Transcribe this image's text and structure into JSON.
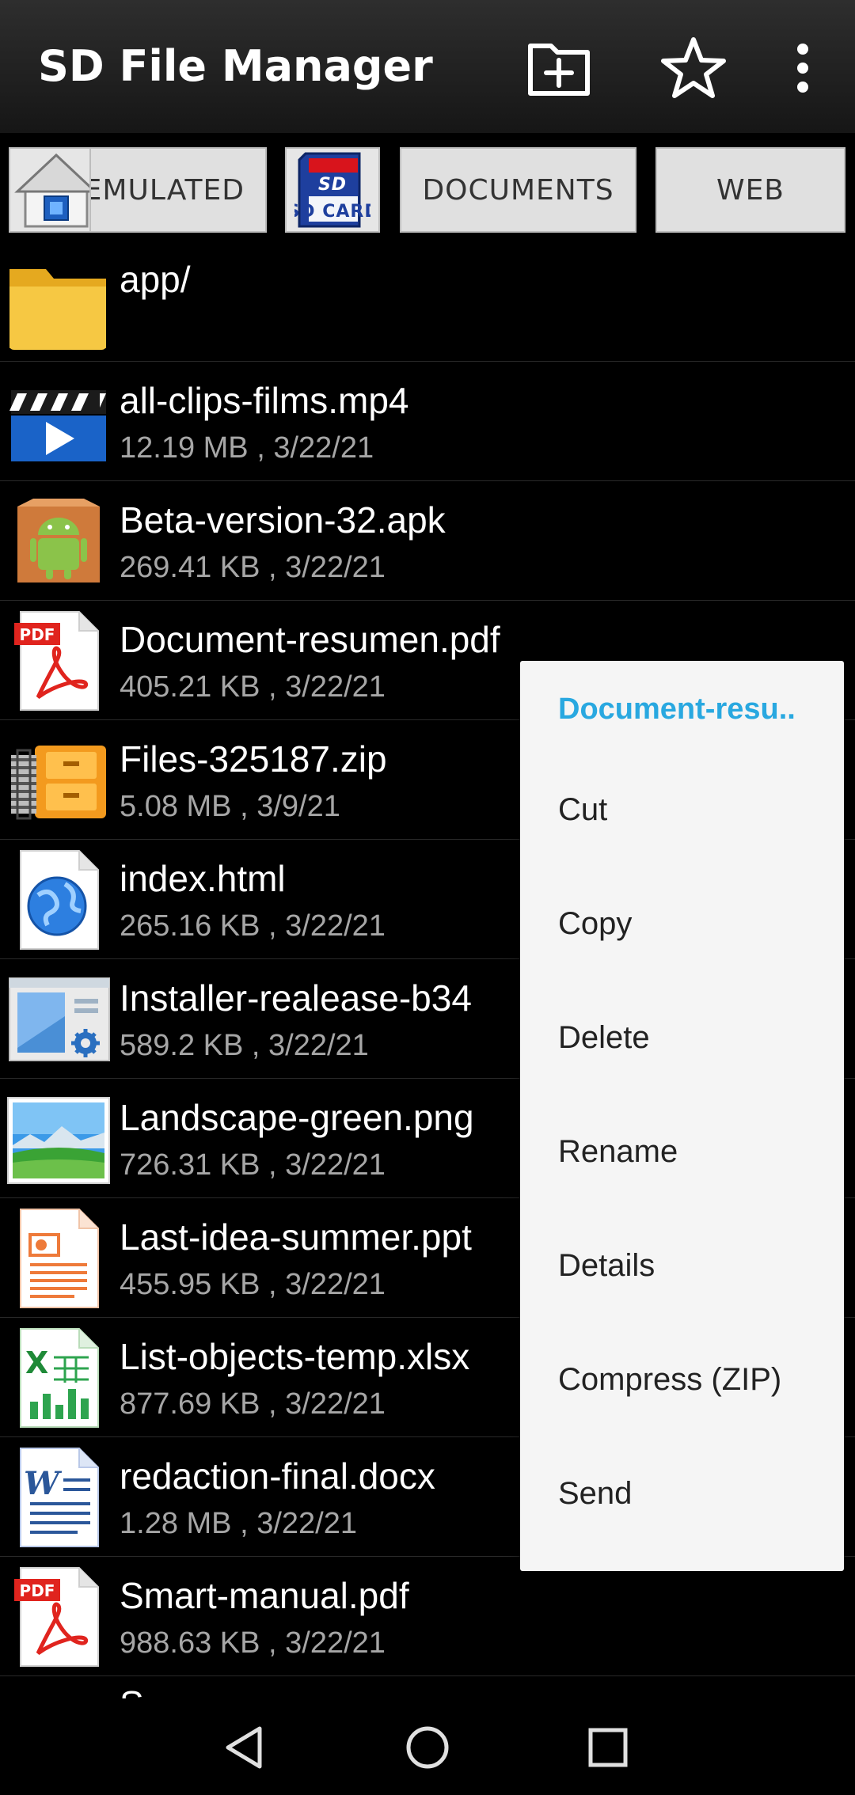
{
  "app": {
    "title": "SD File Manager"
  },
  "toolbar": {
    "new_folder_icon": "folder-plus-icon",
    "favorites_icon": "star-icon",
    "overflow_icon": "more-vert-icon"
  },
  "locations": [
    {
      "type": "home",
      "label": ""
    },
    {
      "type": "text",
      "label": "EMULATED"
    },
    {
      "type": "sdcard",
      "label": "SD CARD"
    },
    {
      "type": "text",
      "label": "DOCUMENTS"
    },
    {
      "type": "text",
      "label": "WEB"
    }
  ],
  "files": [
    {
      "name": "app/",
      "meta": "",
      "icon": "folder-icon"
    },
    {
      "name": "all-clips-films.mp4",
      "meta": "12.19 MB , 3/22/21",
      "icon": "video-icon"
    },
    {
      "name": "Beta-version-32.apk",
      "meta": "269.41 KB , 3/22/21",
      "icon": "android-apk-icon"
    },
    {
      "name": "Document-resumen.pdf",
      "meta": "405.21 KB , 3/22/21",
      "icon": "pdf-icon"
    },
    {
      "name": "Files-325187.zip",
      "meta": "5.08 MB , 3/9/21",
      "icon": "zip-icon"
    },
    {
      "name": "index.html",
      "meta": "265.16 KB , 3/22/21",
      "icon": "html-globe-icon"
    },
    {
      "name": "Installer-realease-b34",
      "meta": "589.2 KB , 3/22/21",
      "icon": "installer-icon"
    },
    {
      "name": "Landscape-green.png",
      "meta": "726.31 KB , 3/22/21",
      "icon": "image-icon"
    },
    {
      "name": "Last-idea-summer.ppt",
      "meta": "455.95 KB , 3/22/21",
      "icon": "ppt-icon"
    },
    {
      "name": "List-objects-temp.xlsx",
      "meta": "877.69 KB , 3/22/21",
      "icon": "excel-icon"
    },
    {
      "name": "redaction-final.docx",
      "meta": "1.28 MB , 3/22/21",
      "icon": "word-icon"
    },
    {
      "name": "Smart-manual.pdf",
      "meta": "988.63 KB , 3/22/21",
      "icon": "pdf-icon"
    },
    {
      "name": "S",
      "meta": "",
      "icon": "file-icon"
    }
  ],
  "context_menu": {
    "title": "Document-resu..",
    "items": [
      "Cut",
      "Copy",
      "Delete",
      "Rename",
      "Details",
      "Compress (ZIP)",
      "Send"
    ]
  },
  "navbar": {
    "back_icon": "back-triangle-icon",
    "home_icon": "home-circle-icon",
    "recents_icon": "recents-square-icon"
  },
  "colors": {
    "accent": "#29a8e0",
    "background": "#000000",
    "menu_bg": "#f5f5f5"
  }
}
